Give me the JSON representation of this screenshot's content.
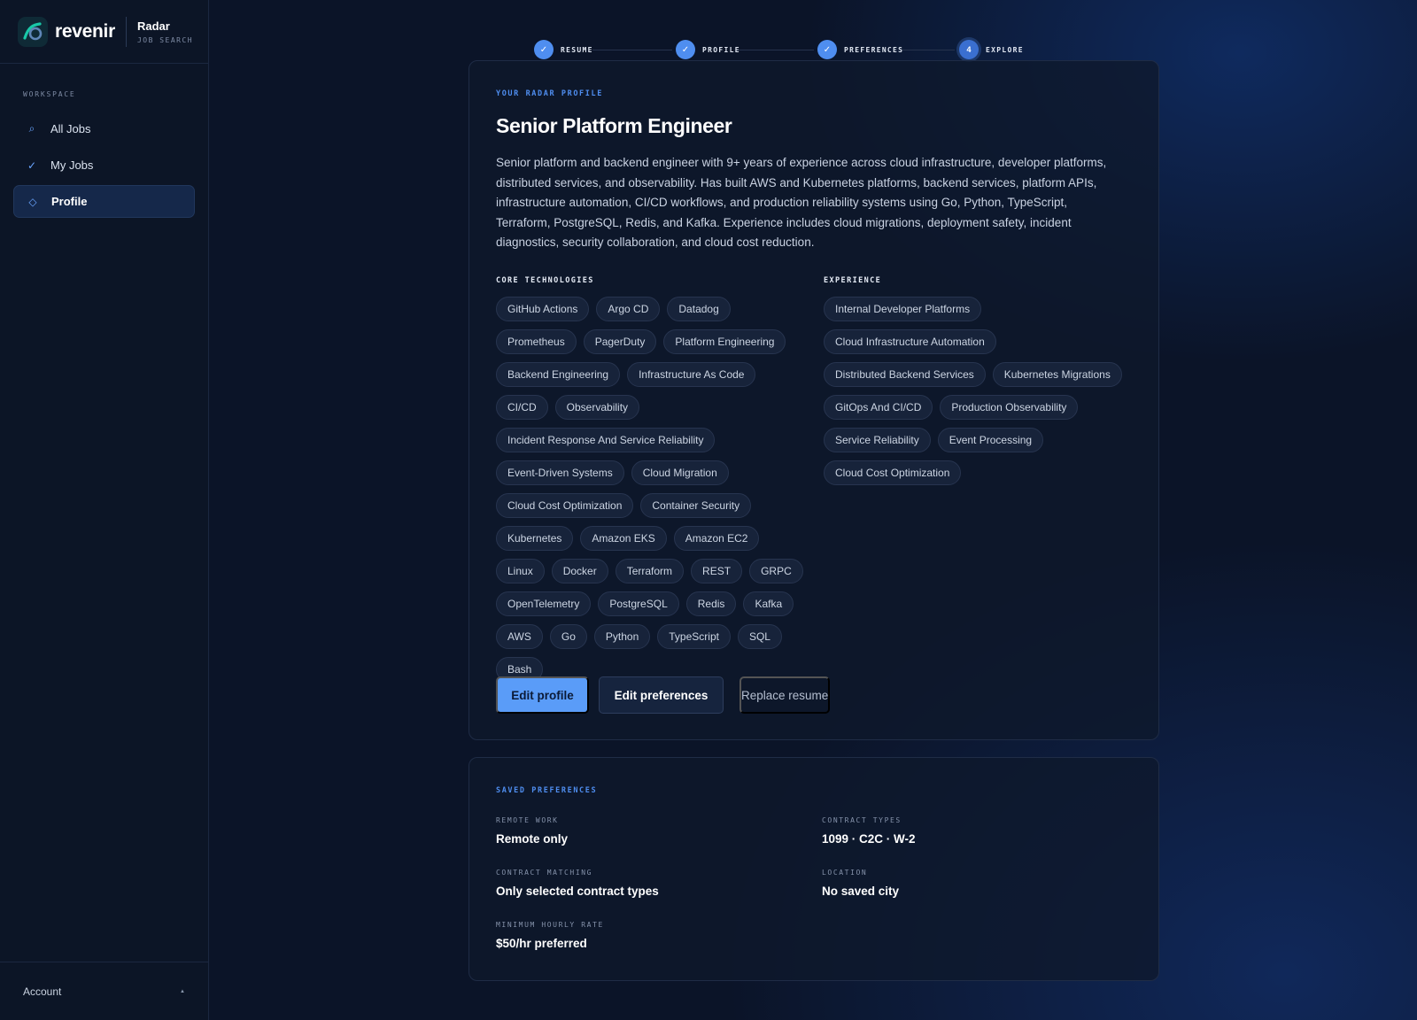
{
  "brand": {
    "name": "revenir",
    "product": "Radar",
    "product_sub": "JOB SEARCH"
  },
  "sidebar": {
    "heading": "WORKSPACE",
    "items": [
      {
        "label": "All Jobs",
        "icon": "search-icon",
        "glyph": "⌕",
        "active": false
      },
      {
        "label": "My Jobs",
        "icon": "check-icon",
        "glyph": "✓",
        "active": false
      },
      {
        "label": "Profile",
        "icon": "diamond-icon",
        "glyph": "◇",
        "active": true
      }
    ],
    "account": {
      "label": "Account",
      "caret": "▲"
    }
  },
  "stepper": {
    "steps": [
      {
        "label": "RESUME",
        "mark": "✓",
        "state": "done"
      },
      {
        "label": "PROFILE",
        "mark": "✓",
        "state": "done"
      },
      {
        "label": "PREFERENCES",
        "mark": "✓",
        "state": "done"
      },
      {
        "label": "EXPLORE",
        "mark": "4",
        "state": "current"
      }
    ]
  },
  "profile": {
    "eyebrow": "YOUR RADAR PROFILE",
    "title": "Senior Platform Engineer",
    "summary": "Senior platform and backend engineer with 9+ years of experience across cloud infrastructure, developer platforms, distributed services, and observability. Has built AWS and Kubernetes platforms, backend services, platform APIs, infrastructure automation, CI/CD workflows, and production reliability systems using Go, Python, TypeScript, Terraform, PostgreSQL, Redis, and Kafka. Experience includes cloud migrations, deployment safety, incident diagnostics, security collaboration, and cloud cost reduction.",
    "tech_heading": "CORE TECHNOLOGIES",
    "technologies": [
      "GitHub Actions",
      "Argo CD",
      "Datadog",
      "Prometheus",
      "PagerDuty",
      "Platform Engineering",
      "Backend Engineering",
      "Infrastructure As Code",
      "CI/CD",
      "Observability",
      "Incident Response And Service Reliability",
      "Event-Driven Systems",
      "Cloud Migration",
      "Cloud Cost Optimization",
      "Container Security",
      "Kubernetes",
      "Amazon EKS",
      "Amazon EC2",
      "Linux",
      "Docker",
      "Terraform",
      "REST",
      "GRPC",
      "OpenTelemetry",
      "PostgreSQL",
      "Redis",
      "Kafka",
      "AWS",
      "Go",
      "Python",
      "TypeScript",
      "SQL",
      "Bash"
    ],
    "exp_heading": "EXPERIENCE",
    "experience": [
      "Internal Developer Platforms",
      "Cloud Infrastructure Automation",
      "Distributed Backend Services",
      "Kubernetes Migrations",
      "GitOps And CI/CD",
      "Production Observability",
      "Service Reliability",
      "Event Processing",
      "Cloud Cost Optimization"
    ],
    "actions": {
      "edit_profile": "Edit profile",
      "edit_preferences": "Edit preferences",
      "replace_resume": "Replace resume"
    }
  },
  "preferences": {
    "eyebrow": "SAVED PREFERENCES",
    "remote_work": {
      "label": "REMOTE WORK",
      "value": "Remote only"
    },
    "contract_types": {
      "label": "CONTRACT TYPES",
      "value": "1099 · C2C · W-2"
    },
    "contract_matching": {
      "label": "CONTRACT MATCHING",
      "value": "Only selected contract types"
    },
    "location": {
      "label": "LOCATION",
      "value": "No saved city"
    },
    "min_rate": {
      "label": "MINIMUM HOURLY RATE",
      "value": "$50/hr preferred"
    }
  },
  "colors": {
    "accent": "#4f8ef0",
    "primary_button": "#5a9cf8",
    "background": "#0b1428",
    "card": "#0e182c"
  }
}
